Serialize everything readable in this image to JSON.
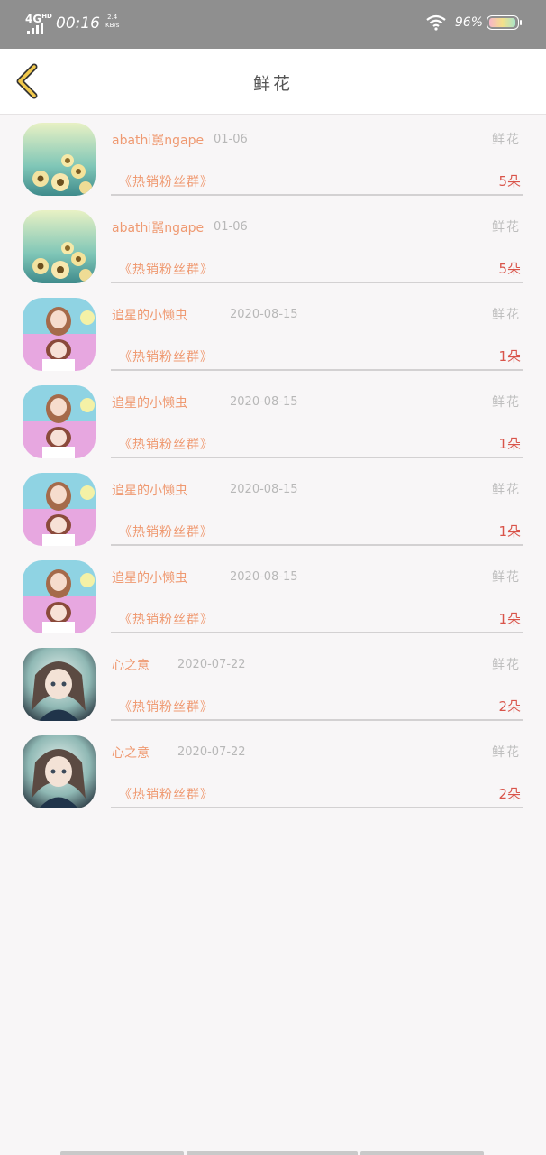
{
  "status": {
    "network": "4G",
    "network_sup": "HD",
    "time": "00:16",
    "speed_value": "2.4",
    "speed_unit": "KB/s",
    "battery": "96%"
  },
  "header": {
    "title": "鲜花"
  },
  "records": [
    {
      "name": "abathi嚚ngape",
      "date": "01-06",
      "tag": "鲜花",
      "group": "《热销粉丝群》",
      "count": "5朵",
      "avatar": "flower-avatar"
    },
    {
      "name": "abathi嚚ngape",
      "date": "01-06",
      "tag": "鲜花",
      "group": "《热销粉丝群》",
      "count": "5朵",
      "avatar": "flower-avatar"
    },
    {
      "name": "追星的小懒虫",
      "date": "2020-08-15",
      "tag": "鲜花",
      "group": "《热销粉丝群》",
      "count": "1朵",
      "avatar": "girl-avatar"
    },
    {
      "name": "追星的小懒虫",
      "date": "2020-08-15",
      "tag": "鲜花",
      "group": "《热销粉丝群》",
      "count": "1朵",
      "avatar": "girl-avatar"
    },
    {
      "name": "追星的小懒虫",
      "date": "2020-08-15",
      "tag": "鲜花",
      "group": "《热销粉丝群》",
      "count": "1朵",
      "avatar": "girl-avatar"
    },
    {
      "name": "追星的小懒虫",
      "date": "2020-08-15",
      "tag": "鲜花",
      "group": "《热销粉丝群》",
      "count": "1朵",
      "avatar": "girl-avatar"
    },
    {
      "name": "心之意",
      "date": "2020-07-22",
      "tag": "鲜花",
      "group": "《热销粉丝群》",
      "count": "2朵",
      "avatar": "anime-avatar"
    },
    {
      "name": "心之意",
      "date": "2020-07-22",
      "tag": "鲜花",
      "group": "《热销粉丝群》",
      "count": "2朵",
      "avatar": "anime-avatar"
    }
  ],
  "colors": {
    "accent_orange": "#ef9a72",
    "count_red": "#d9544a",
    "muted_gray": "#bdbdbd",
    "back_arrow": "#f2c94c"
  }
}
